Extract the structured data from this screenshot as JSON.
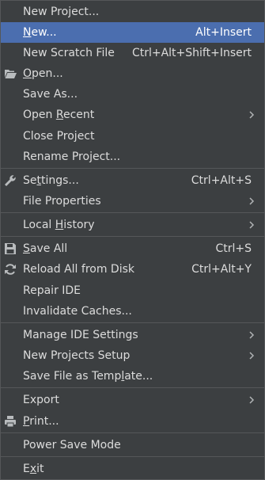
{
  "menu": {
    "items": [
      {
        "label": "New Project...",
        "shortcut": ""
      },
      {
        "pre": "",
        "mn": "N",
        "post": "ew...",
        "shortcut": "Alt+Insert",
        "selected": true
      },
      {
        "label": "New Scratch File",
        "shortcut": "Ctrl+Alt+Shift+Insert"
      },
      {
        "pre": "",
        "mn": "O",
        "post": "pen...",
        "icon": "folder-open-icon"
      },
      {
        "label": "Save As..."
      },
      {
        "pre": "Open ",
        "mn": "R",
        "post": "ecent",
        "submenu": true
      },
      {
        "label": "Close Project"
      },
      {
        "label": "Rename Project..."
      },
      {
        "pre": "Se",
        "mn": "t",
        "post": "tings...",
        "shortcut": "Ctrl+Alt+S",
        "icon": "wrench-icon"
      },
      {
        "label": "File Properties",
        "submenu": true
      },
      {
        "pre": "Local ",
        "mn": "H",
        "post": "istory",
        "submenu": true
      },
      {
        "pre": "",
        "mn": "S",
        "post": "ave All",
        "shortcut": "Ctrl+S",
        "icon": "save-icon"
      },
      {
        "label": "Reload All from Disk",
        "shortcut": "Ctrl+Alt+Y",
        "icon": "reload-icon"
      },
      {
        "label": "Repair IDE"
      },
      {
        "label": "Invalidate Caches..."
      },
      {
        "label": "Manage IDE Settings",
        "submenu": true
      },
      {
        "label": "New Projects Setup",
        "submenu": true
      },
      {
        "pre": "Save File as Temp",
        "mn": "l",
        "post": "ate..."
      },
      {
        "label": "Export",
        "submenu": true
      },
      {
        "pre": "",
        "mn": "P",
        "post": "rint...",
        "icon": "print-icon"
      },
      {
        "label": "Power Save Mode"
      },
      {
        "pre": "E",
        "mn": "x",
        "post": "it"
      }
    ]
  }
}
